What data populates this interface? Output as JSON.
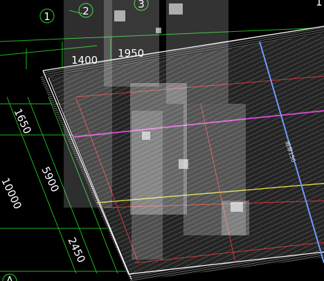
{
  "colors": {
    "background": "#000000",
    "grid_axis": "#1fb81f",
    "slab_edge": "#ffffff",
    "axis_blue": "#6f9cff",
    "beam_magenta": "#d04ad0",
    "beam_yellow": "#d6d23a",
    "rebar_red": "#d03a3a"
  },
  "axes": {
    "axis_1": "1",
    "axis_2": "2",
    "axis_3": "3",
    "axis_a": "A"
  },
  "dimensions": {
    "top_1400": "1400",
    "top_1950": "1950",
    "left_1650": "1650",
    "left_5900": "5900",
    "left_10000": "10000",
    "left_2450": "2450",
    "top_right_cut": "1"
  },
  "annotation": {
    "slab_note": "板厚150"
  }
}
